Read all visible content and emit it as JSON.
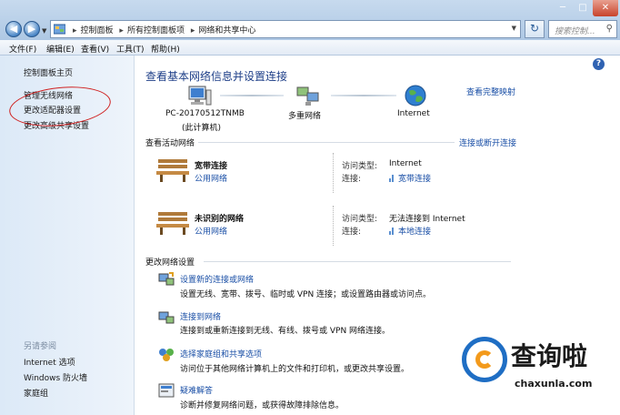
{
  "address_bar": {
    "crumbs": [
      "控制面板",
      "所有控制面板项",
      "网络和共享中心"
    ],
    "search_placeholder": "搜索控制..."
  },
  "menu": [
    "文件(F)",
    "编辑(E)",
    "查看(V)",
    "工具(T)",
    "帮助(H)"
  ],
  "sidebar": {
    "links": [
      "控制面板主页",
      "管理无线网络",
      "更改适配器设置",
      "更改高级共享设置"
    ],
    "see_also_title": "另请参阅",
    "see_also": [
      "Internet 选项",
      "Windows 防火墙",
      "家庭组"
    ]
  },
  "main": {
    "title": "查看基本网络信息并设置连接",
    "full_map_link": "查看完整映射",
    "map": {
      "computer_name": "PC-20170512TNMB",
      "computer_sub": "(此计算机)",
      "network": "多重网络",
      "internet": "Internet"
    },
    "active_header": "查看活动网络",
    "connect_link": "连接或断开连接",
    "networks": [
      {
        "name": "宽带连接",
        "type": "公用网络",
        "access_key": "访问类型:",
        "access_val": "Internet",
        "conn_key": "连接:",
        "conn_val": "宽带连接"
      },
      {
        "name": "未识别的网络",
        "type": "公用网络",
        "access_key": "访问类型:",
        "access_val": "无法连接到 Internet",
        "conn_key": "连接:",
        "conn_val": "本地连接"
      }
    ],
    "settings_header": "更改网络设置",
    "tasks": [
      {
        "link": "设置新的连接或网络",
        "desc": "设置无线、宽带、拨号、临时或 VPN 连接；或设置路由器或访问点。"
      },
      {
        "link": "连接到网络",
        "desc": "连接到或重新连接到无线、有线、拨号或 VPN 网络连接。"
      },
      {
        "link": "选择家庭组和共享选项",
        "desc": "访问位于其他网络计算机上的文件和打印机，或更改共享设置。"
      },
      {
        "link": "疑难解答",
        "desc": "诊断并修复网络问题，或获得故障排除信息。"
      }
    ]
  },
  "watermark": {
    "text": "查询啦",
    "url": "chaxunla.com"
  }
}
